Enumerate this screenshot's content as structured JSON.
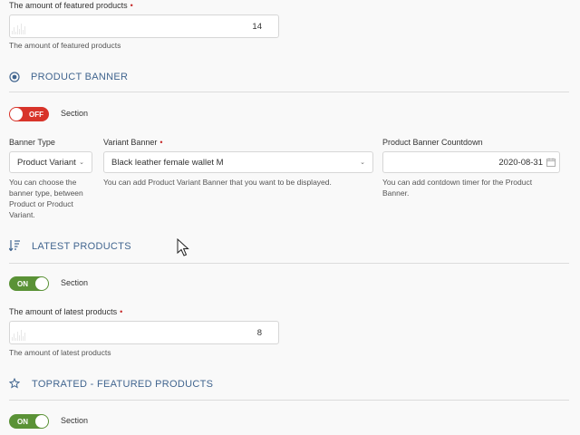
{
  "featured": {
    "label": "The amount of featured products",
    "value": "14",
    "help": "The amount of featured products"
  },
  "product_banner": {
    "title": "PRODUCT BANNER",
    "icon": "radio-target-icon",
    "toggle_state": "OFF",
    "toggle_label": "Section",
    "banner_type": {
      "label": "Banner Type",
      "value": "Product Variant",
      "help": "You can choose the banner type, between Product or Product Variant."
    },
    "variant_banner": {
      "label": "Variant Banner",
      "value": "Black leather female wallet M",
      "help": "You can add Product Variant Banner that you want to be displayed."
    },
    "countdown": {
      "label": "Product Banner Countdown",
      "value": "2020-08-31",
      "help": "You can add contdown timer for the Product Banner."
    }
  },
  "latest_products": {
    "title": "LATEST PRODUCTS",
    "icon": "sort-descending-icon",
    "toggle_state": "ON",
    "toggle_label": "Section",
    "amount": {
      "label": "The amount of latest products",
      "value": "8",
      "help": "The amount of latest products"
    }
  },
  "toprated": {
    "title": "TOPRATED - FEATURED PRODUCTS",
    "icon": "star-outline-icon",
    "toggle_state": "ON",
    "toggle_label": "Section"
  },
  "colors": {
    "accent": "#41658f",
    "required": "#c62828",
    "toggle_off": "#d8342a",
    "toggle_on": "#5a9236"
  }
}
